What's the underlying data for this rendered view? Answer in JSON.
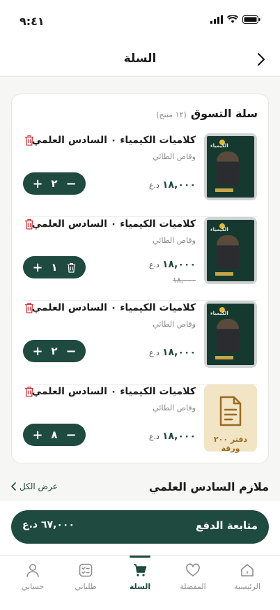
{
  "status": {
    "time": "٩:٤١"
  },
  "header": {
    "title": "السلة"
  },
  "cart": {
    "title": "سلة التسوق",
    "count": "(١٢ منتج)",
    "items": [
      {
        "name": "كلاميات الكيمياء ٠ السادس العلمي",
        "author": "وقاص الطائي",
        "price": "١٨,٠٠٠",
        "currency": "د.ع",
        "old_price": "",
        "qty": "٢",
        "minus": "−",
        "plus": "+",
        "book_title": "الكيمياء",
        "thumb": "book"
      },
      {
        "name": "كلاميات الكيمياء ٠ السادس العلمي",
        "author": "وقاص الطائي",
        "price": "١٨,٠٠٠",
        "currency": "د.ع",
        "old_price": "١٨,٠٠٠",
        "qty": "١",
        "minus": "trash",
        "plus": "+",
        "book_title": "الكيمياء",
        "thumb": "book"
      },
      {
        "name": "كلاميات الكيمياء ٠ السادس العلمي",
        "author": "وقاص الطائي",
        "price": "١٨,٠٠٠",
        "currency": "د.ع",
        "old_price": "",
        "qty": "٢",
        "minus": "−",
        "plus": "+",
        "book_title": "الكيمياء",
        "thumb": "book"
      },
      {
        "name": "كلاميات الكيمياء ٠ السادس العلمي",
        "author": "وقاص الطائي",
        "price": "١٨,٠٠٠",
        "currency": "د.ع",
        "old_price": "",
        "qty": "٨",
        "minus": "−",
        "plus": "+",
        "book_title": "",
        "thumb": "notebook",
        "thumb_label": "دفتر ٢٠٠ ورقة"
      }
    ]
  },
  "section": {
    "title": "ملازم السادس العلمي",
    "view_all": "عرض الكل"
  },
  "checkout": {
    "label": "متابعة الدفع",
    "total": "٦٧,٠٠٠ د.ع"
  },
  "tabs": [
    {
      "label": "الرئيسية",
      "icon": "home-icon"
    },
    {
      "label": "المفضلة",
      "icon": "heart-icon"
    },
    {
      "label": "السلة",
      "icon": "cart-icon",
      "active": true
    },
    {
      "label": "طلباتي",
      "icon": "orders-icon"
    },
    {
      "label": "حسابي",
      "icon": "profile-icon"
    }
  ],
  "colors": {
    "brand": "#1f4a3f",
    "danger": "#d4343a",
    "notebook_bg": "#f2e5c5"
  }
}
